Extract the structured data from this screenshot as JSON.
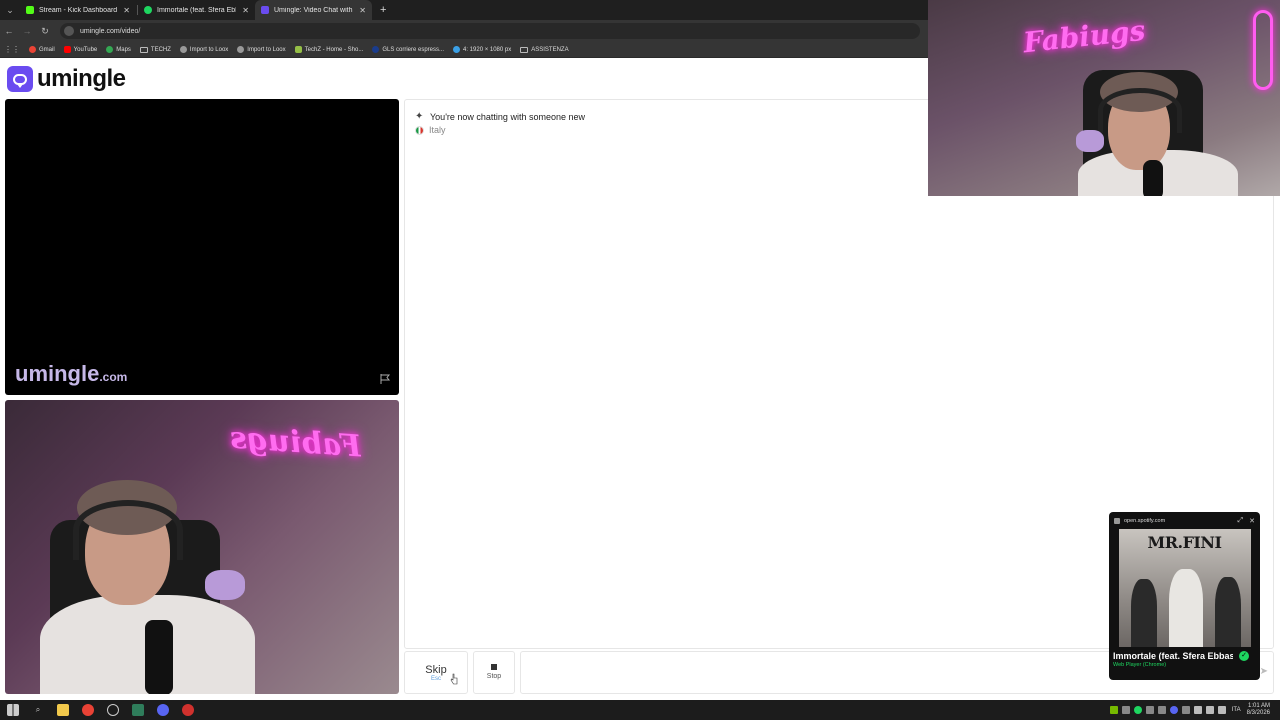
{
  "browser": {
    "tabs": [
      {
        "title": "Stream - Kick Dashboard",
        "color": "#53fc18",
        "active": false
      },
      {
        "title": "Immortale (feat. Sfera Ebb...",
        "color": "#1ed760",
        "active": false
      },
      {
        "title": "Umingle: Video Chat with S...",
        "color": "#6a4cf0",
        "active": true
      }
    ],
    "url": "umingle.com/video/",
    "bookmarks": [
      {
        "label": "Gmail",
        "color": "#ea4335",
        "type": "icon"
      },
      {
        "label": "YouTube",
        "color": "#ff0000",
        "type": "icon"
      },
      {
        "label": "Maps",
        "color": "#34a853",
        "type": "icon"
      },
      {
        "label": "TECHZ",
        "color": "",
        "type": "folder"
      },
      {
        "label": "Import to Loox",
        "color": "#999999",
        "type": "icon"
      },
      {
        "label": "Import to Loox",
        "color": "#999999",
        "type": "icon"
      },
      {
        "label": "TechZ - Home - Sho...",
        "color": "#95bf47",
        "type": "icon"
      },
      {
        "label": "GLS corriere espress...",
        "color": "#1a3c8c",
        "type": "icon"
      },
      {
        "label": "4: 1920 × 1080 px",
        "color": "#3ba0e6",
        "type": "icon"
      },
      {
        "label": "ASSISTENZA",
        "color": "",
        "type": "folder"
      }
    ]
  },
  "site": {
    "logo_text": "umingle",
    "brand_color": "#6a4cf0",
    "watermark_main": "umingle",
    "watermark_domain": ".com"
  },
  "chat": {
    "status_message": "You're now chatting with someone new",
    "country": "Italy"
  },
  "controls": {
    "skip_label": "Skip",
    "skip_key": "Esc",
    "stop_label": "Stop",
    "message_placeholder": ""
  },
  "webcam": {
    "neon_text_main": "Fabiugs",
    "neon_text_self": "Fabiugs"
  },
  "mini_player": {
    "source_host": "open.spotify.com",
    "album_title": "MR.FINI",
    "song_title": "Immortale (feat. Sfera Ebbasta)",
    "player_label": "Web Player (Chrome)"
  },
  "taskbar": {
    "language": "ITA",
    "time": "1:01 AM",
    "date": "8/3/2026"
  }
}
